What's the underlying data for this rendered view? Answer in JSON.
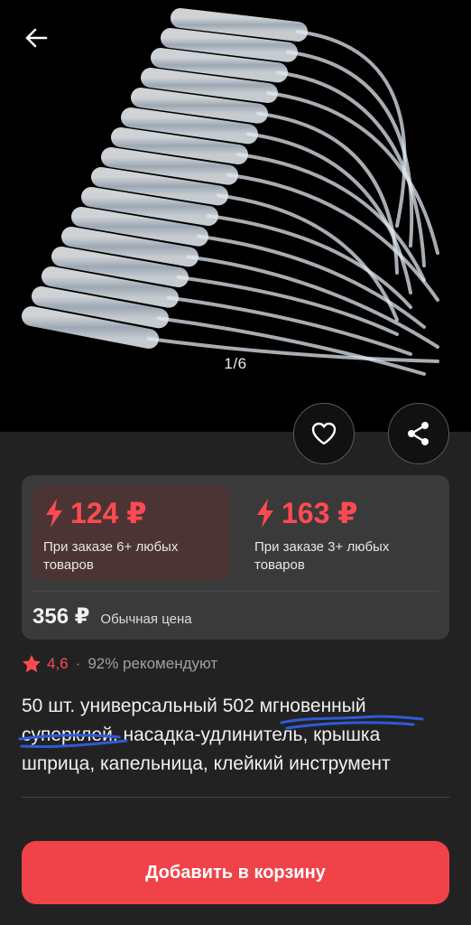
{
  "gallery": {
    "counter": "1/6",
    "image_name": "product-photo"
  },
  "actions": {
    "back_icon": "arrow-left-icon",
    "favorite_icon": "heart-icon",
    "share_icon": "share-icon"
  },
  "prices": {
    "tiers": [
      {
        "amount": "124 ₽",
        "note": "При заказе 6+ любых товаров",
        "icon": "lightning-icon"
      },
      {
        "amount": "163 ₽",
        "note": "При заказе 3+ любых товаров",
        "icon": "lightning-icon"
      }
    ],
    "regular_amount": "356 ₽",
    "regular_label": "Обычная цена"
  },
  "rating": {
    "value": "4,6",
    "separator": "·",
    "recommend": "92% рекомендуют",
    "icon": "star-icon"
  },
  "product": {
    "title": "50 шт. универсальный 502 мгновенный суперклей, насадка-удлинитель, крышка шприца, капельница, клейкий инструмент"
  },
  "cart": {
    "button_label": "Добавить в корзину"
  },
  "colors": {
    "accent": "#f04349",
    "price_red": "#ff4a52",
    "background": "#222222",
    "card": "#3a3a3a"
  }
}
